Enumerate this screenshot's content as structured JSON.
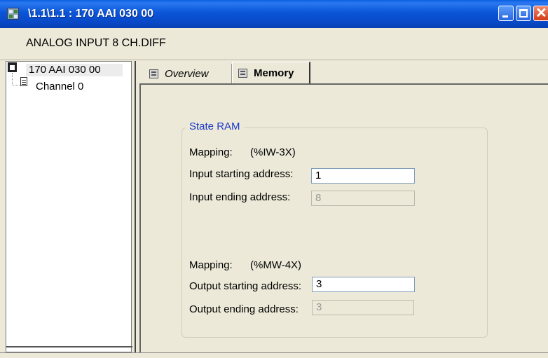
{
  "window": {
    "title": "\\1.1\\1.1 : 170 AAI 030 00",
    "minimize_icon": "minimize-icon",
    "maximize_icon": "maximize-icon",
    "close_icon": "close-icon",
    "close_glyph": "✕"
  },
  "module": {
    "description": "ANALOG INPUT 8 CH.DIFF"
  },
  "tree": {
    "root": {
      "label": "170 AAI 030 00",
      "icon": "module-icon"
    },
    "children": [
      {
        "label": "Channel 0",
        "icon": "document-icon"
      }
    ]
  },
  "tabs": [
    {
      "label": "Overview",
      "icon": "tab-grid-icon",
      "active": false
    },
    {
      "label": "Memory",
      "icon": "tab-grid-icon",
      "active": true
    }
  ],
  "state_ram": {
    "group_label": "State RAM",
    "input_mapping_label": "Mapping:",
    "input_mapping_value": "(%IW-3X)",
    "input_start_label": "Input starting address:",
    "input_start_value": "1",
    "input_end_label": "Input ending address:",
    "input_end_value": "8",
    "output_mapping_label": "Mapping:",
    "output_mapping_value": "(%MW-4X)",
    "output_start_label": "Output starting address:",
    "output_start_value": "3",
    "output_end_label": "Output ending address:",
    "output_end_value": "3"
  }
}
